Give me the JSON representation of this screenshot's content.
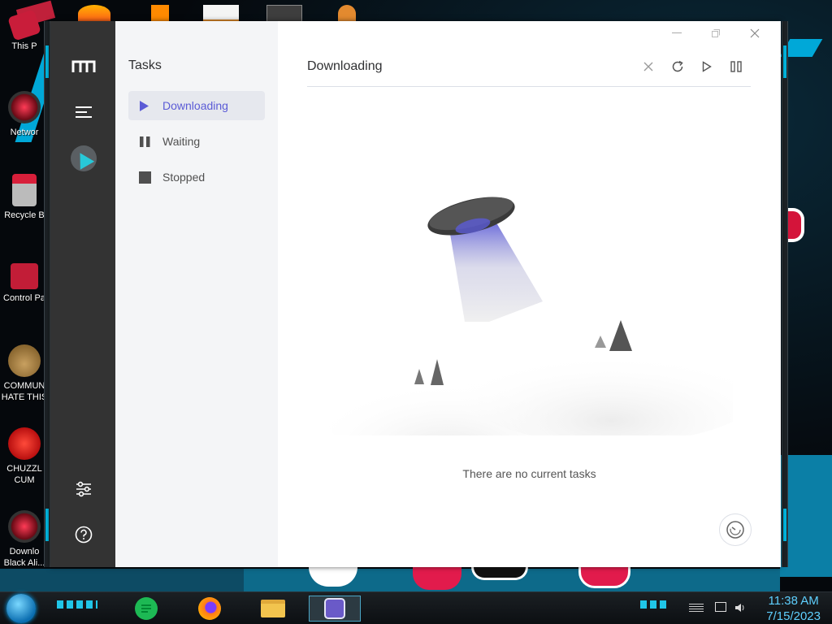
{
  "desktop": {
    "icons": [
      {
        "label": "This P",
        "name": "desktop-icon-this-pc"
      },
      {
        "label": "Networ",
        "name": "desktop-icon-network"
      },
      {
        "label": "Recycle B",
        "name": "desktop-icon-recycle-bin"
      },
      {
        "label": "Control Pa",
        "name": "desktop-icon-control-panel"
      },
      {
        "label": "COMMUN HATE THIS",
        "name": "desktop-icon-commun"
      },
      {
        "label": "CHUZZL CUM",
        "name": "desktop-icon-chuzzle"
      },
      {
        "label": "Downlo Black Ali...",
        "name": "desktop-icon-download"
      }
    ]
  },
  "app": {
    "sidebar": {
      "title": "Tasks",
      "items": [
        {
          "label": "Downloading",
          "icon": "play-icon",
          "active": true
        },
        {
          "label": "Waiting",
          "icon": "pause-icon",
          "active": false
        },
        {
          "label": "Stopped",
          "icon": "stop-icon",
          "active": false
        }
      ]
    },
    "header": {
      "title": "Downloading"
    },
    "toolbar": {
      "icons": [
        "close-icon",
        "refresh-icon",
        "resume-all-icon",
        "pause-all-icon"
      ]
    },
    "empty": {
      "text": "There are no current tasks"
    },
    "colors": {
      "rail": "#333333",
      "subnav": "#f4f5f7",
      "accent": "#5b5bd6"
    }
  },
  "taskbar": {
    "time": "11:38 AM",
    "date": "7/15/2023"
  }
}
